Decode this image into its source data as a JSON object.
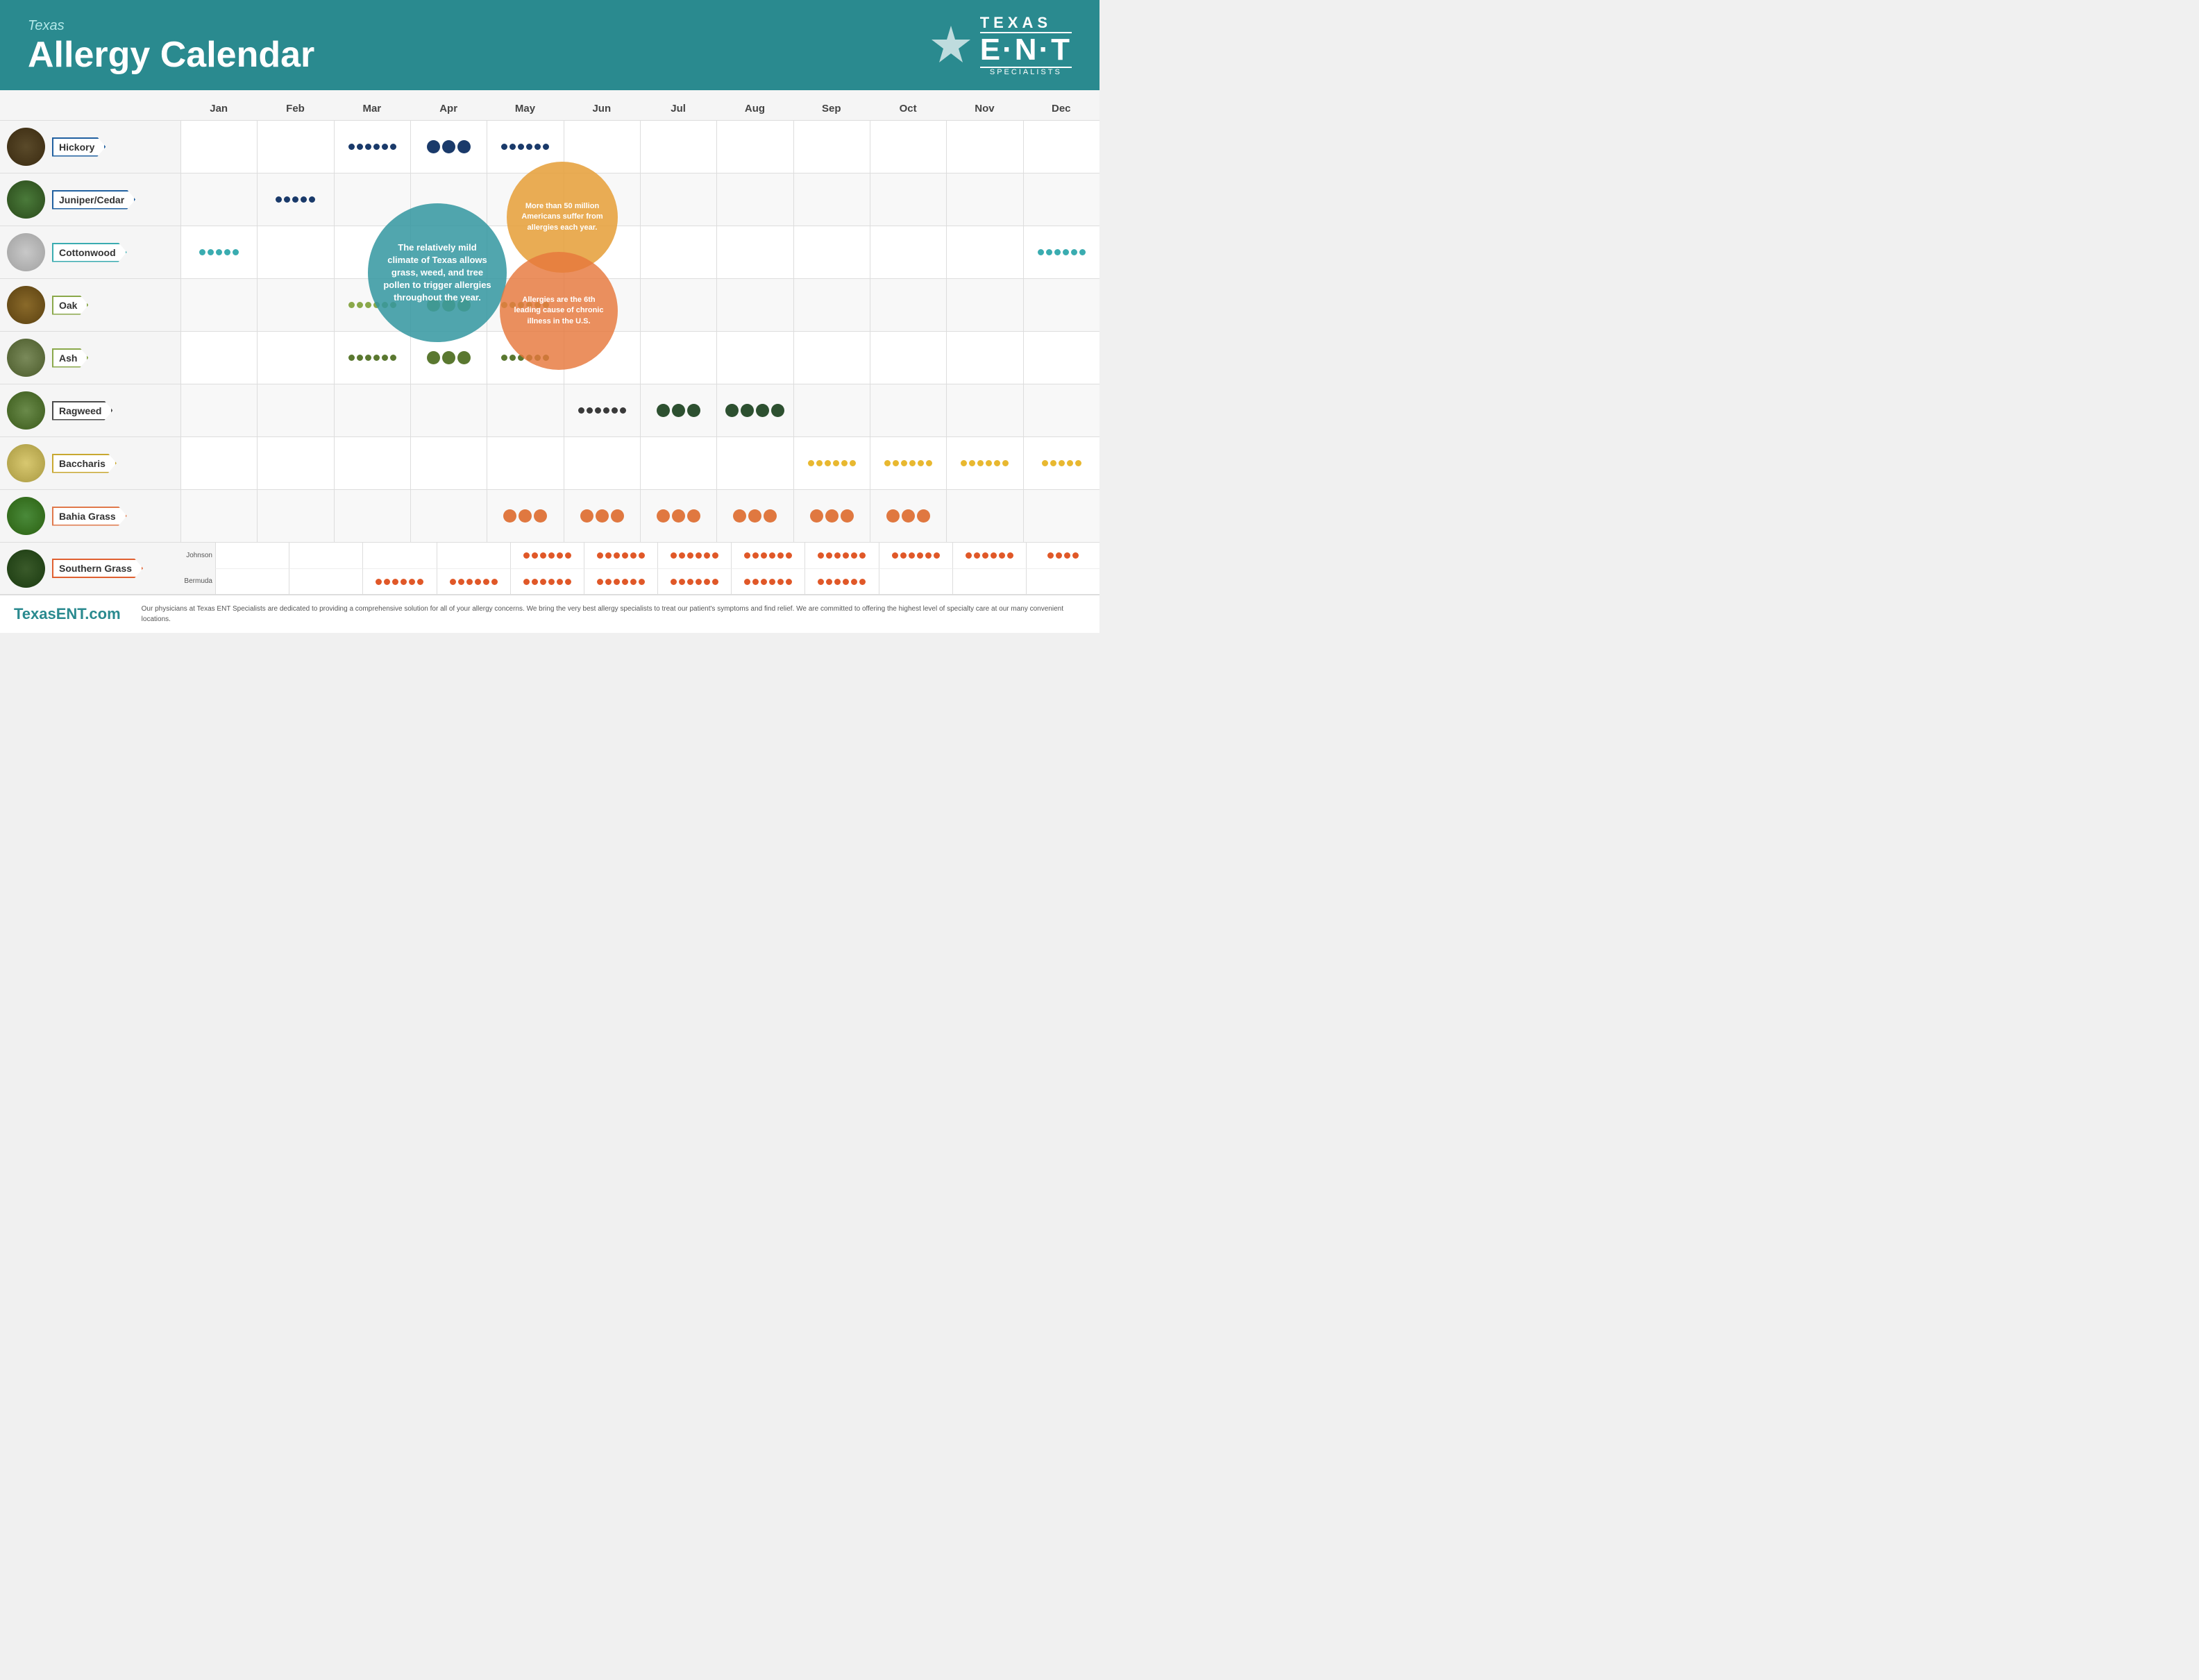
{
  "header": {
    "subtitle": "Texas",
    "title": "Allergy Calendar",
    "logo": {
      "texas": "TEXAS",
      "ent": "E·N·T",
      "specialists": "SPECIALISTS"
    }
  },
  "months": [
    "Jan",
    "Feb",
    "Mar",
    "Apr",
    "May",
    "Jun",
    "Jul",
    "Aug",
    "Sep",
    "Oct",
    "Nov",
    "Dec"
  ],
  "rows": [
    {
      "id": "hickory",
      "name": "Hickory",
      "imgClass": "img-hickory",
      "dots": {
        "2": {
          "color": "navy",
          "sizes": [
            "sm",
            "sm",
            "sm",
            "sm",
            "sm",
            "sm"
          ]
        },
        "3": {
          "color": "navy",
          "sizes": [
            "lg",
            "lg",
            "lg"
          ]
        },
        "4": {
          "color": "navy",
          "sizes": [
            "sm",
            "sm",
            "sm",
            "sm",
            "sm",
            "sm"
          ]
        }
      }
    },
    {
      "id": "juniper",
      "name": "Juniper/Cedar",
      "imgClass": "img-juniper",
      "dots": {
        "1": {
          "color": "navy",
          "sizes": [
            "sm",
            "sm",
            "sm",
            "sm",
            "sm"
          ]
        }
      }
    },
    {
      "id": "cottonwood",
      "name": "Cottonwood",
      "imgClass": "img-cottonwood",
      "dots": {
        "0": {
          "color": "teal",
          "sizes": [
            "sm",
            "sm",
            "sm",
            "sm",
            "sm"
          ]
        },
        "11": {
          "color": "teal",
          "sizes": [
            "sm",
            "sm",
            "sm",
            "sm",
            "sm",
            "sm"
          ]
        }
      }
    },
    {
      "id": "oak",
      "name": "Oak",
      "imgClass": "img-oak",
      "dots": {
        "2": {
          "color": "olive",
          "sizes": [
            "sm",
            "sm",
            "sm",
            "sm",
            "sm",
            "sm"
          ]
        },
        "3": {
          "color": "olive",
          "sizes": [
            "lg",
            "lg",
            "lg"
          ]
        },
        "4": {
          "color": "olive",
          "sizes": [
            "sm",
            "sm",
            "sm",
            "sm",
            "sm",
            "sm"
          ]
        }
      }
    },
    {
      "id": "ash",
      "name": "Ash",
      "imgClass": "img-ash",
      "dots": {
        "2": {
          "color": "olive-dark",
          "sizes": [
            "sm",
            "sm",
            "sm",
            "sm",
            "sm",
            "sm"
          ]
        },
        "3": {
          "color": "olive-dark",
          "sizes": [
            "lg",
            "lg",
            "lg"
          ]
        },
        "4": {
          "color": "olive-dark",
          "sizes": [
            "sm",
            "sm",
            "sm",
            "sm",
            "sm",
            "sm"
          ]
        }
      }
    },
    {
      "id": "ragweed",
      "name": "Ragweed",
      "imgClass": "img-ragweed",
      "dots": {
        "5": {
          "color": "charcoal",
          "sizes": [
            "sm",
            "sm",
            "sm",
            "sm",
            "sm",
            "sm"
          ]
        },
        "6": {
          "color": "dark-green",
          "sizes": [
            "lg",
            "lg",
            "lg"
          ]
        },
        "7": {
          "color": "dark-green",
          "sizes": [
            "lg",
            "lg",
            "lg",
            "lg"
          ]
        }
      }
    },
    {
      "id": "baccharis",
      "name": "Baccharis",
      "imgClass": "img-baccharis",
      "dots": {
        "8": {
          "color": "gold",
          "sizes": [
            "sm",
            "sm",
            "sm",
            "sm",
            "sm",
            "sm"
          ]
        },
        "9": {
          "color": "gold",
          "sizes": [
            "sm",
            "sm",
            "sm",
            "sm",
            "sm",
            "sm"
          ]
        },
        "10": {
          "color": "gold",
          "sizes": [
            "sm",
            "sm",
            "sm",
            "sm",
            "sm",
            "sm"
          ]
        },
        "11": {
          "color": "gold",
          "sizes": [
            "sm",
            "sm",
            "sm",
            "sm",
            "sm"
          ]
        }
      }
    },
    {
      "id": "bahia",
      "name": "Bahia Grass",
      "imgClass": "img-bahia",
      "dots": {
        "4": {
          "color": "orange",
          "sizes": [
            "lg",
            "lg",
            "lg"
          ]
        },
        "5": {
          "color": "orange",
          "sizes": [
            "lg",
            "lg",
            "lg"
          ]
        },
        "6": {
          "color": "orange",
          "sizes": [
            "lg",
            "lg",
            "lg"
          ]
        },
        "7": {
          "color": "orange",
          "sizes": [
            "lg",
            "lg",
            "lg"
          ]
        },
        "8": {
          "color": "orange",
          "sizes": [
            "lg",
            "lg",
            "lg"
          ]
        },
        "9": {
          "color": "orange",
          "sizes": [
            "lg",
            "lg",
            "lg"
          ]
        }
      }
    },
    {
      "id": "southern",
      "name": "Southern Grass",
      "imgClass": "img-southern",
      "subRows": {
        "johnson": {
          "label": "Johnson",
          "dots": {
            "4": {
              "color": "red-orange",
              "sizes": [
                "sm",
                "sm",
                "sm",
                "sm",
                "sm",
                "sm"
              ]
            },
            "5": {
              "color": "red-orange",
              "sizes": [
                "sm",
                "sm",
                "sm",
                "sm",
                "sm",
                "sm"
              ]
            },
            "6": {
              "color": "red-orange",
              "sizes": [
                "sm",
                "sm",
                "sm",
                "sm",
                "sm",
                "sm"
              ]
            },
            "7": {
              "color": "red-orange",
              "sizes": [
                "sm",
                "sm",
                "sm",
                "sm",
                "sm",
                "sm"
              ]
            },
            "8": {
              "color": "red-orange",
              "sizes": [
                "sm",
                "sm",
                "sm",
                "sm",
                "sm",
                "sm"
              ]
            },
            "9": {
              "color": "red-orange",
              "sizes": [
                "sm",
                "sm",
                "sm",
                "sm",
                "sm",
                "sm"
              ]
            },
            "10": {
              "color": "red-orange",
              "sizes": [
                "sm",
                "sm",
                "sm",
                "sm",
                "sm",
                "sm"
              ]
            },
            "11": {
              "color": "red-orange",
              "sizes": [
                "sm",
                "sm",
                "sm",
                "sm"
              ]
            }
          }
        },
        "bermuda": {
          "label": "Bermuda",
          "dots": {
            "2": {
              "color": "red-orange",
              "sizes": [
                "sm",
                "sm",
                "sm",
                "sm",
                "sm",
                "sm"
              ]
            },
            "3": {
              "color": "red-orange",
              "sizes": [
                "sm",
                "sm",
                "sm",
                "sm",
                "sm",
                "sm"
              ]
            },
            "4": {
              "color": "red-orange",
              "sizes": [
                "sm",
                "sm",
                "sm",
                "sm",
                "sm",
                "sm"
              ]
            },
            "5": {
              "color": "red-orange",
              "sizes": [
                "sm",
                "sm",
                "sm",
                "sm",
                "sm",
                "sm"
              ]
            },
            "6": {
              "color": "red-orange",
              "sizes": [
                "sm",
                "sm",
                "sm",
                "sm",
                "sm",
                "sm"
              ]
            },
            "7": {
              "color": "red-orange",
              "sizes": [
                "sm",
                "sm",
                "sm",
                "sm",
                "sm",
                "sm"
              ]
            },
            "8": {
              "color": "red-orange",
              "sizes": [
                "sm",
                "sm",
                "sm",
                "sm",
                "sm",
                "sm"
              ]
            }
          }
        }
      }
    }
  ],
  "bubbles": {
    "teal": "The relatively mild climate of Texas allows grass, weed, and tree pollen to trigger allergies throughout the year.",
    "orange_top": "More than 50 million Americans suffer from allergies each year.",
    "orange_bottom": "Allergies are the 6th leading cause of chronic illness in the U.S."
  },
  "footer": {
    "website": "TexasENT.com",
    "text": "Our physicians at Texas ENT Specialists are dedicated to providing a comprehensive solution for all of your allergy concerns. We bring the very best allergy specialists to treat our patient's symptoms and find relief. We are committed to offering the highest level of specialty care at our many convenient locations."
  }
}
